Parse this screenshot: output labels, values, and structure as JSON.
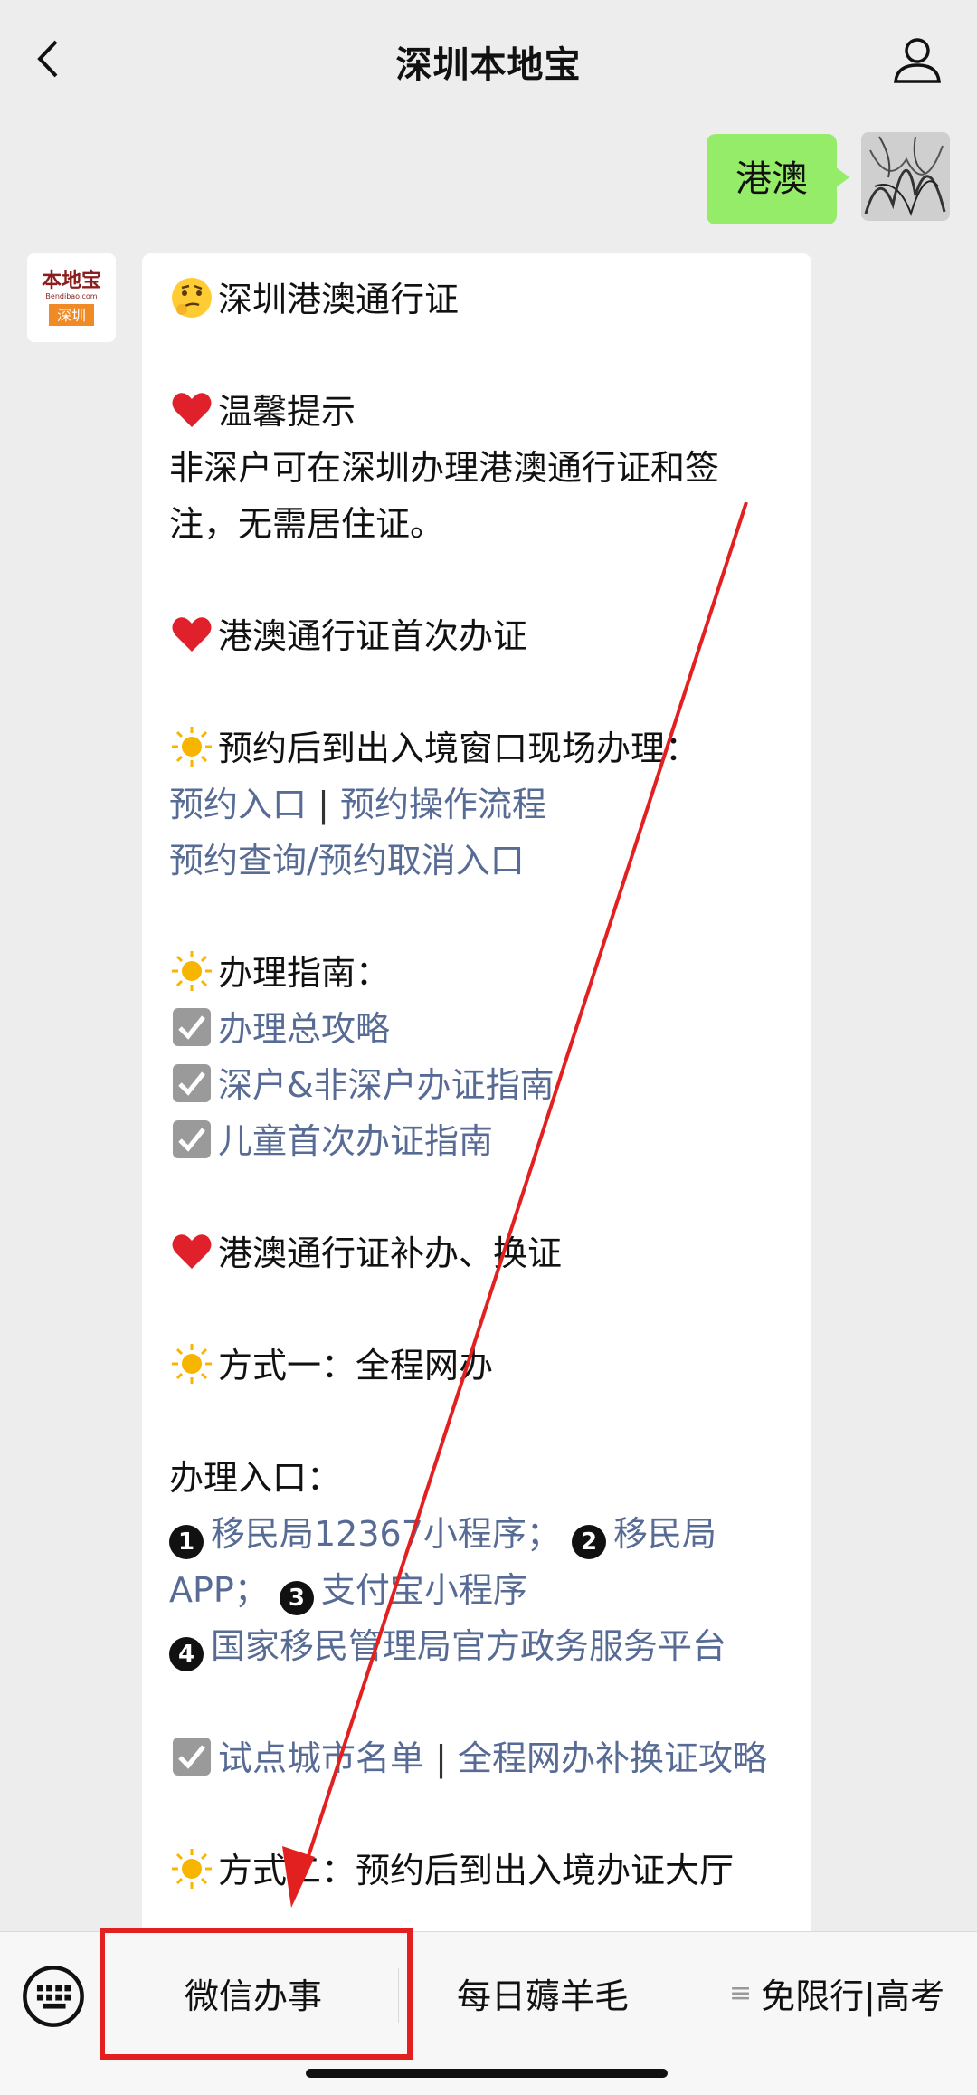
{
  "header": {
    "title": "深圳本地宝"
  },
  "user_message": {
    "text": "港澳"
  },
  "bot": {
    "avatar_text_top": "本地宝",
    "avatar_text_sub": "Bendibao.com",
    "avatar_text_city": "深圳",
    "lines": {
      "l1": "深圳港澳通行证",
      "l2": "温馨提示",
      "l3": "非深户可在深圳办理港澳通行证和签注，无需居住证。",
      "l4": "港澳通行证首次办证",
      "l5": "预约后到出入境窗口现场办理：",
      "l6a": "预约入口",
      "l6b": "预约操作流程",
      "l7": "预约查询/预约取消入口",
      "l8": "办理指南：",
      "l9": "办理总攻略",
      "l10": "深户&非深户办证指南",
      "l11": "儿童首次办证指南",
      "l12": "港澳通行证补办、换证",
      "l13": "方式一：全程网办",
      "l14": "办理入口：",
      "n1": "1",
      "l15a": "移民局12367小程序；",
      "n2": "2",
      "l15b": "移民局APP；",
      "n3": "3",
      "l15c": "支付宝小程序",
      "n4": "4",
      "l16": "国家移民管理局官方政务服务平台",
      "l17a": "试点城市名单",
      "l17b": "全程网办补换证攻略",
      "l18": "方式二：预约后到出入境办证大厅",
      "sep": "|"
    }
  },
  "menu": {
    "item1": "微信办事",
    "item2": "每日薅羊毛",
    "item3": "免限行|高考",
    "item3_icon": "≡"
  },
  "colors": {
    "link": "#576b95",
    "highlight": "#e32020",
    "user_bubble": "#95ec69"
  }
}
